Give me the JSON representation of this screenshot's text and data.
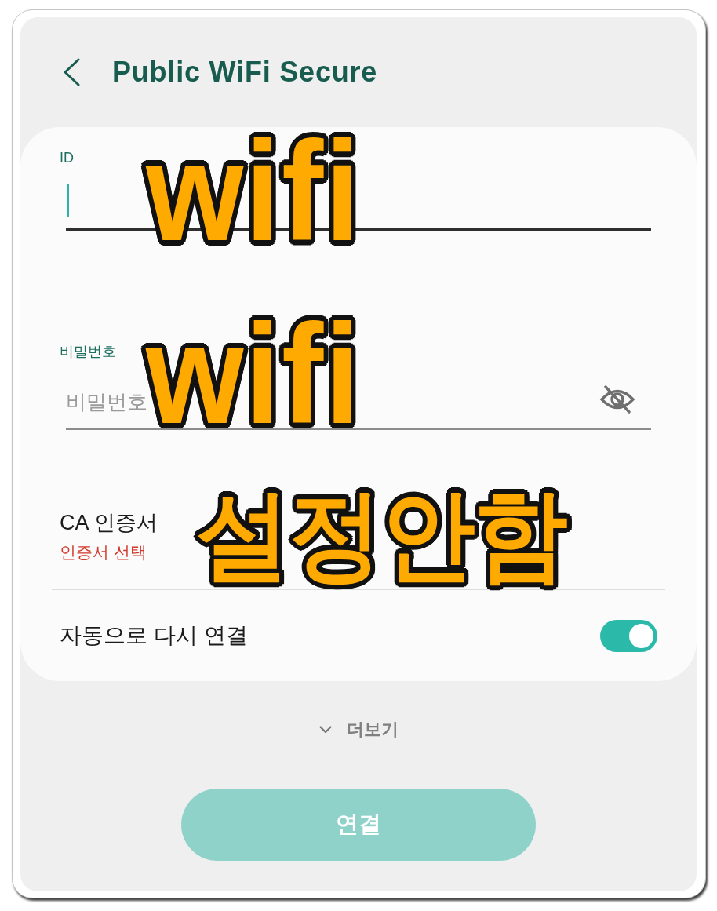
{
  "header": {
    "title": "Public WiFi Secure"
  },
  "fields": [
    {
      "kind": "text",
      "label": "ID",
      "focused": true,
      "annotation": "wifi"
    },
    {
      "kind": "password",
      "label": "비밀번호",
      "placeholder": "비밀번호",
      "focused": false,
      "annotation": "wifi"
    }
  ],
  "certificate": {
    "label": "CA 인증서",
    "value": "인증서 선택",
    "annotation": "설정안함"
  },
  "auto_reconnect": {
    "label": "자동으로 다시 연결",
    "on": true
  },
  "more": {
    "label": "더보기"
  },
  "connect_button": {
    "label": "연결",
    "disabled": true
  }
}
